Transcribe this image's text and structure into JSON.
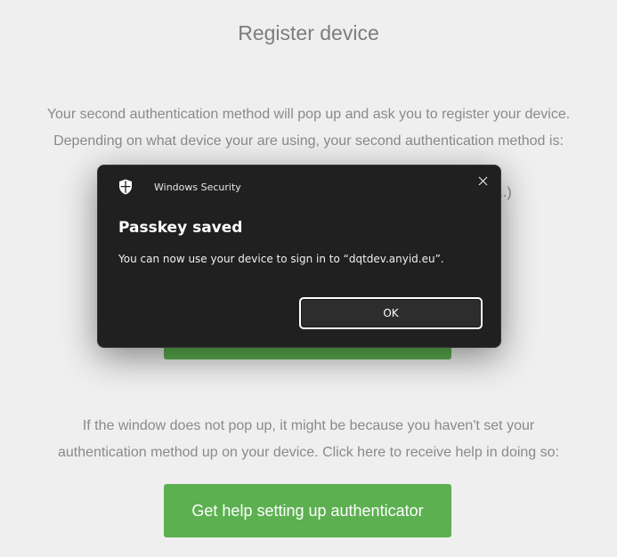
{
  "page": {
    "title": "Register device",
    "intro_line1": "Your second authentication method will pop up and ask you to register your device.",
    "intro_line2": "Depending on what device your are using, your second authentication method is:",
    "obscured_text": "...)",
    "help_line1": "If the window does not pop up, it might be because you haven't set your",
    "help_line2": "authentication method up on your device. Click here to receive help in doing so:",
    "help_button_label": "Get help setting up authenticator"
  },
  "dialog": {
    "app_name": "Windows Security",
    "app_icon": "shield-icon",
    "close_icon": "close-icon",
    "heading": "Passkey saved",
    "message": "You can now use your device to sign in to “dqtdev.anyid.eu”.",
    "ok_label": "OK"
  },
  "colors": {
    "page_background": "#efefef",
    "text_gray": "#8a8a8a",
    "button_green": "#5cb050",
    "dialog_background": "#202020",
    "dialog_text": "#ffffff"
  }
}
